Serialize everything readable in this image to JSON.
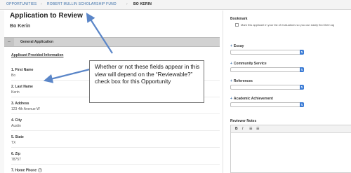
{
  "breadcrumb": {
    "items": [
      "OPPORTUNITIES",
      "ROBERT MULLIN SCHOLARSHIP FUND",
      "BO KERIN"
    ],
    "separator": "›"
  },
  "application": {
    "title": "Application to Review",
    "applicant_name": "Bo Kerin",
    "section": {
      "toggle": "–",
      "title": "General Application"
    },
    "subsection_title": "Applicant Provided Information",
    "fields": [
      {
        "label": "1. First Name",
        "value": "Bo"
      },
      {
        "label": "2. Last Name",
        "value": "Kerin"
      },
      {
        "label": "3. Address",
        "value": "123 4th Avenue W"
      },
      {
        "label": "4. City",
        "value": "Austin"
      },
      {
        "label": "5. State",
        "value": "TX"
      },
      {
        "label": "6. Zip",
        "value": "78757"
      },
      {
        "label": "7. Home Phone",
        "value": ""
      }
    ],
    "help_icon": "?"
  },
  "bookmark": {
    "title": "Bookmark",
    "checkbox_checked": false,
    "text": "Mark this applicant in your list of evaluations so you can easily find them ag"
  },
  "criteria": [
    {
      "label": "Essay",
      "selected": ""
    },
    {
      "label": "Community Service",
      "selected": ""
    },
    {
      "label": "References",
      "selected": ""
    },
    {
      "label": "Academic Achievement",
      "selected": ""
    }
  ],
  "notes": {
    "title": "Reviewer Notes",
    "toolbar": [
      "B",
      "I",
      "☰",
      "☰"
    ]
  },
  "callout": {
    "text": "Whether or not these fields appear in this view will depend on the “Reviewable?” check box for this Opportunity"
  },
  "colors": {
    "link": "#3a6ea8",
    "accent_blue": "#3a7bd5",
    "arrow": "#5b86c8",
    "section_bg": "#d2d2d2"
  }
}
